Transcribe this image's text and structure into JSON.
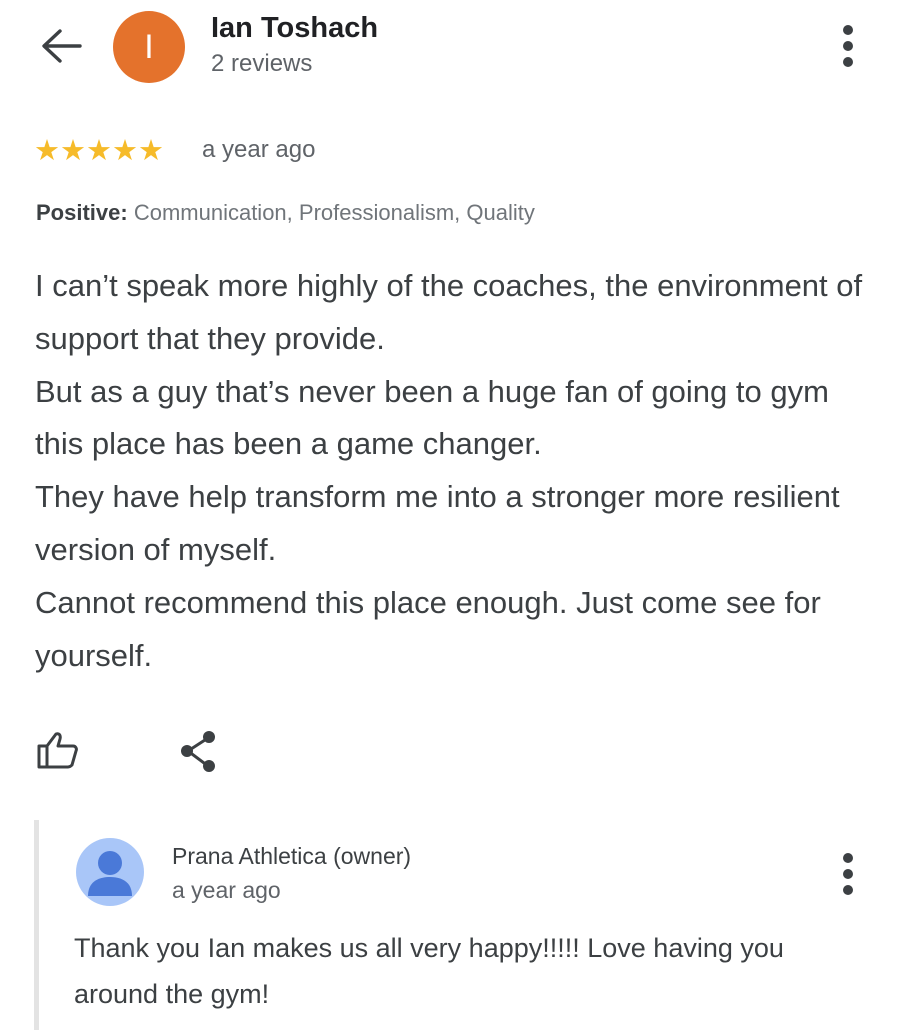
{
  "header": {
    "back_icon": "arrow-back-icon",
    "avatar_letter": "I",
    "avatar_color": "#e4722c",
    "reviewer_name": "Ian Toshach",
    "review_count": "2 reviews",
    "more_icon": "more-vert-icon"
  },
  "review": {
    "stars": "★★★★★",
    "rating": 5,
    "star_color": "#f6bb2a",
    "time": "a year ago",
    "positive_label": "Positive:",
    "positive_values": "Communication, Professionalism, Quality",
    "lines": [
      "I can’t speak more highly of the coaches, the environment of support that they provide.",
      "But as a guy that’s never been a huge fan of going to gym this place has been a game changer.",
      "They have help transform me into a stronger more resilient version of myself.",
      "Cannot recommend this place enough. Just come see for yourself."
    ]
  },
  "actions": {
    "like_icon": "thumbs-up-icon",
    "share_icon": "share-icon"
  },
  "owner_response": {
    "name": "Prana Athletica (owner)",
    "time": "a year ago",
    "text": "Thank you Ian makes us all very happy!!!!! Love having you around the gym!",
    "avatar_icon": "person-icon",
    "more_icon": "more-vert-icon"
  }
}
